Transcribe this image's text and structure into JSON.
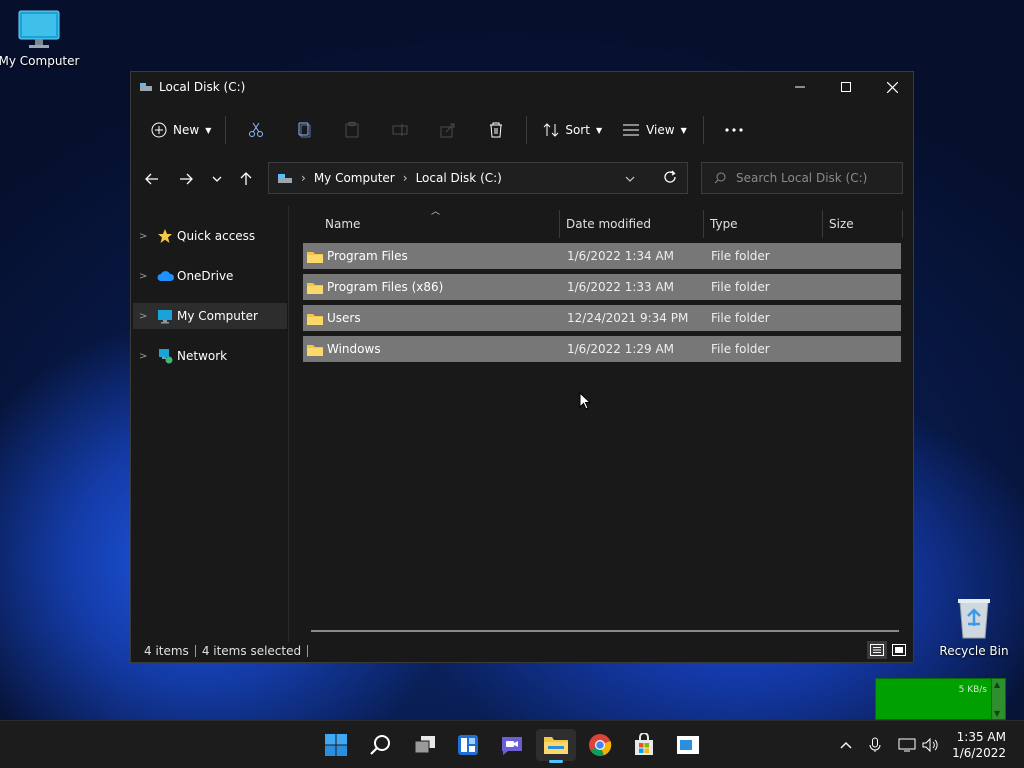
{
  "desktop": {
    "my_computer": "My Computer",
    "recycle_bin": "Recycle Bin"
  },
  "window": {
    "title": "Local Disk (C:)",
    "controls": {
      "minimize": "minimize-icon",
      "maximize": "maximize-icon",
      "close": "close-icon"
    }
  },
  "toolbar": {
    "new_label": "New",
    "sort_label": "Sort",
    "view_label": "View"
  },
  "address": {
    "crumbs": [
      "My Computer",
      "Local Disk (C:)"
    ],
    "separator": "›"
  },
  "search": {
    "placeholder": "Search Local Disk (C:)"
  },
  "nav": {
    "items": [
      {
        "label": "Quick access",
        "icon": "star-icon"
      },
      {
        "label": "OneDrive",
        "icon": "cloud-icon"
      },
      {
        "label": "My Computer",
        "icon": "computer-icon",
        "selected": true
      },
      {
        "label": "Network",
        "icon": "network-icon"
      }
    ]
  },
  "list": {
    "columns": [
      "Name",
      "Date modified",
      "Type",
      "Size"
    ],
    "rows": [
      {
        "name": "Program Files",
        "date": "1/6/2022 1:34 AM",
        "type": "File folder",
        "size": ""
      },
      {
        "name": "Program Files (x86)",
        "date": "1/6/2022 1:33 AM",
        "type": "File folder",
        "size": ""
      },
      {
        "name": "Users",
        "date": "12/24/2021 9:34 PM",
        "type": "File folder",
        "size": ""
      },
      {
        "name": "Windows",
        "date": "1/6/2022 1:29 AM",
        "type": "File folder",
        "size": ""
      }
    ]
  },
  "status": {
    "count": "4 items",
    "selected": "4 items selected"
  },
  "taskbar": {
    "time": "1:35 AM",
    "date": "1/6/2022"
  },
  "netmon": {
    "rate": "5 KB/s"
  },
  "colors": {
    "accent": "#4cc2ff",
    "selection": "#777777",
    "window_bg": "#191919",
    "taskbar_bg": "#1c1c1c",
    "folder": "#f3c649"
  }
}
